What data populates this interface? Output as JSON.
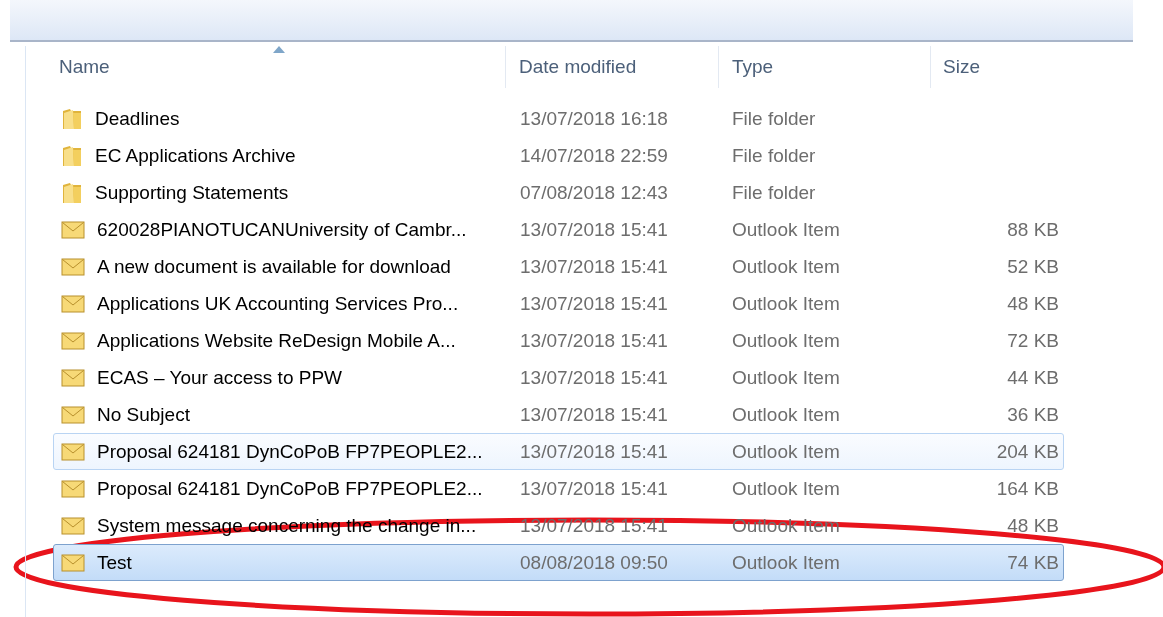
{
  "columns": [
    {
      "label": "Name",
      "sorted": true
    },
    {
      "label": "Date modified",
      "sorted": false
    },
    {
      "label": "Type",
      "sorted": false
    },
    {
      "label": "Size",
      "sorted": false
    }
  ],
  "rows": [
    {
      "kind": "folder",
      "name": "Deadlines",
      "date": "13/07/2018 16:18",
      "type": "File folder",
      "selected": false,
      "hovered": false
    },
    {
      "kind": "folder",
      "name": "EC Applications Archive",
      "date": "14/07/2018 22:59",
      "type": "File folder",
      "selected": false,
      "hovered": false
    },
    {
      "kind": "folder",
      "name": "Supporting Statements",
      "date": "07/08/2018 12:43",
      "type": "File folder",
      "selected": false,
      "hovered": false
    },
    {
      "kind": "email",
      "name": "620028PIANOTUCANUniversity of Cambr...",
      "date": "13/07/2018 15:41",
      "type": "Outlook Item",
      "size": "88 KB",
      "selected": false,
      "hovered": false
    },
    {
      "kind": "email",
      "name": "A new document is available for download",
      "date": "13/07/2018 15:41",
      "type": "Outlook Item",
      "size": "52 KB",
      "selected": false,
      "hovered": false
    },
    {
      "kind": "email",
      "name": "Applications UK Accounting Services Pro...",
      "date": "13/07/2018 15:41",
      "type": "Outlook Item",
      "size": "48 KB",
      "selected": false,
      "hovered": false
    },
    {
      "kind": "email",
      "name": "Applications Website ReDesign  Mobile A...",
      "date": "13/07/2018 15:41",
      "type": "Outlook Item",
      "size": "72 KB",
      "selected": false,
      "hovered": false
    },
    {
      "kind": "email",
      "name": "ECAS – Your access to PPW",
      "date": "13/07/2018 15:41",
      "type": "Outlook Item",
      "size": "44 KB",
      "selected": false,
      "hovered": false
    },
    {
      "kind": "email",
      "name": "No Subject",
      "date": "13/07/2018 15:41",
      "type": "Outlook Item",
      "size": "36 KB",
      "selected": false,
      "hovered": false
    },
    {
      "kind": "email",
      "name": "Proposal 624181 DynCoPoB FP7PEOPLE2...",
      "date": "13/07/2018 15:41",
      "type": "Outlook Item",
      "size": "204 KB",
      "selected": false,
      "hovered": true
    },
    {
      "kind": "email",
      "name": "Proposal 624181 DynCoPoB FP7PEOPLE2...",
      "date": "13/07/2018 15:41",
      "type": "Outlook Item",
      "size": "164 KB",
      "selected": false,
      "hovered": false
    },
    {
      "kind": "email",
      "name": "System message concerning the change in...",
      "date": "13/07/2018 15:41",
      "type": "Outlook Item",
      "size": "48 KB",
      "selected": false,
      "hovered": false
    },
    {
      "kind": "email",
      "name": "Test",
      "date": "08/08/2018 09:50",
      "type": "Outlook Item",
      "size": "74 KB",
      "selected": true,
      "hovered": false
    }
  ],
  "annotation": {
    "kind": "ellipse",
    "color": "#e8141c"
  }
}
